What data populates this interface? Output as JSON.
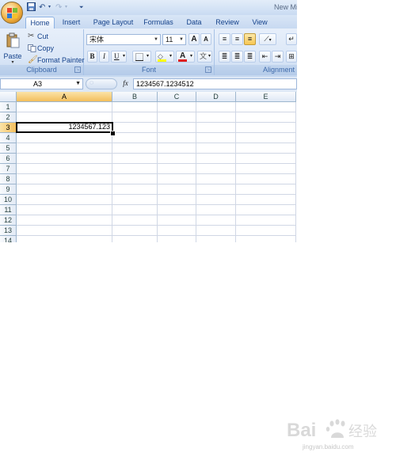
{
  "window": {
    "title": "New Mi"
  },
  "tabs": [
    {
      "label": "Home",
      "active": true
    },
    {
      "label": "Insert"
    },
    {
      "label": "Page Layout"
    },
    {
      "label": "Formulas"
    },
    {
      "label": "Data"
    },
    {
      "label": "Review"
    },
    {
      "label": "View"
    }
  ],
  "ribbon": {
    "clipboard": {
      "label": "Clipboard",
      "paste": "Paste",
      "cut": "Cut",
      "copy": "Copy",
      "format_painter": "Format Painter"
    },
    "font": {
      "label": "Font",
      "font_name": "宋体",
      "font_size": "11",
      "bold": "B",
      "italic": "I",
      "underline": "U",
      "grow": "A",
      "shrink": "A",
      "font_color_letter": "A"
    },
    "alignment": {
      "label": "Alignment"
    }
  },
  "formula_bar": {
    "name_box": "A3",
    "fx": "fx",
    "value": "1234567.1234512"
  },
  "sheet": {
    "columns": [
      "A",
      "B",
      "C",
      "D",
      "E"
    ],
    "rows": [
      "1",
      "2",
      "3",
      "4",
      "5",
      "6",
      "7",
      "8",
      "9",
      "10",
      "11",
      "12",
      "13",
      "14"
    ],
    "selected_column": "A",
    "selected_row": "3",
    "cells": {
      "A3": "1234567.123"
    }
  },
  "watermark": {
    "brand_text": "Bai",
    "brand_suffix": "经验",
    "url": "jingyan.baidu.com"
  },
  "colors": {
    "ribbon_blue": "#dbe7f7",
    "selected_header": "#f3be5c",
    "accent_text": "#15428b"
  }
}
